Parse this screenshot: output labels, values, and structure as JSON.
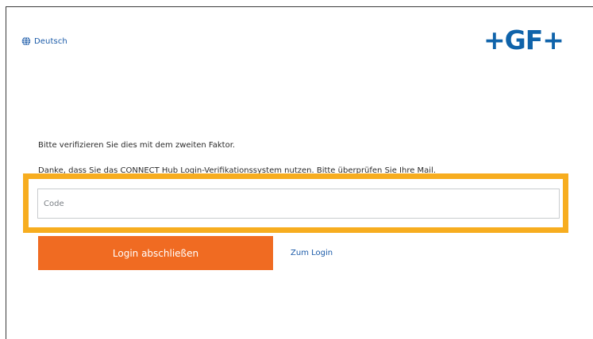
{
  "header": {
    "language_label": "Deutsch",
    "language_icon": "globe-icon",
    "logo_text": "+GF+"
  },
  "main": {
    "instruction": "Bitte verifizieren Sie dies mit dem zweiten Faktor.",
    "info": "Danke, dass Sie das CONNECT Hub Login-Verifikationssystem nutzen. Bitte überprüfen Sie Ihre Mail.",
    "code_field": {
      "placeholder": "Code",
      "value": ""
    },
    "submit_label": "Login abschließen",
    "back_link_label": "Zum Login"
  },
  "colors": {
    "brand_blue": "#0f63aa",
    "link_blue": "#1a5aa8",
    "button_orange": "#f06b22",
    "highlight_yellow": "#f7ad1f"
  }
}
